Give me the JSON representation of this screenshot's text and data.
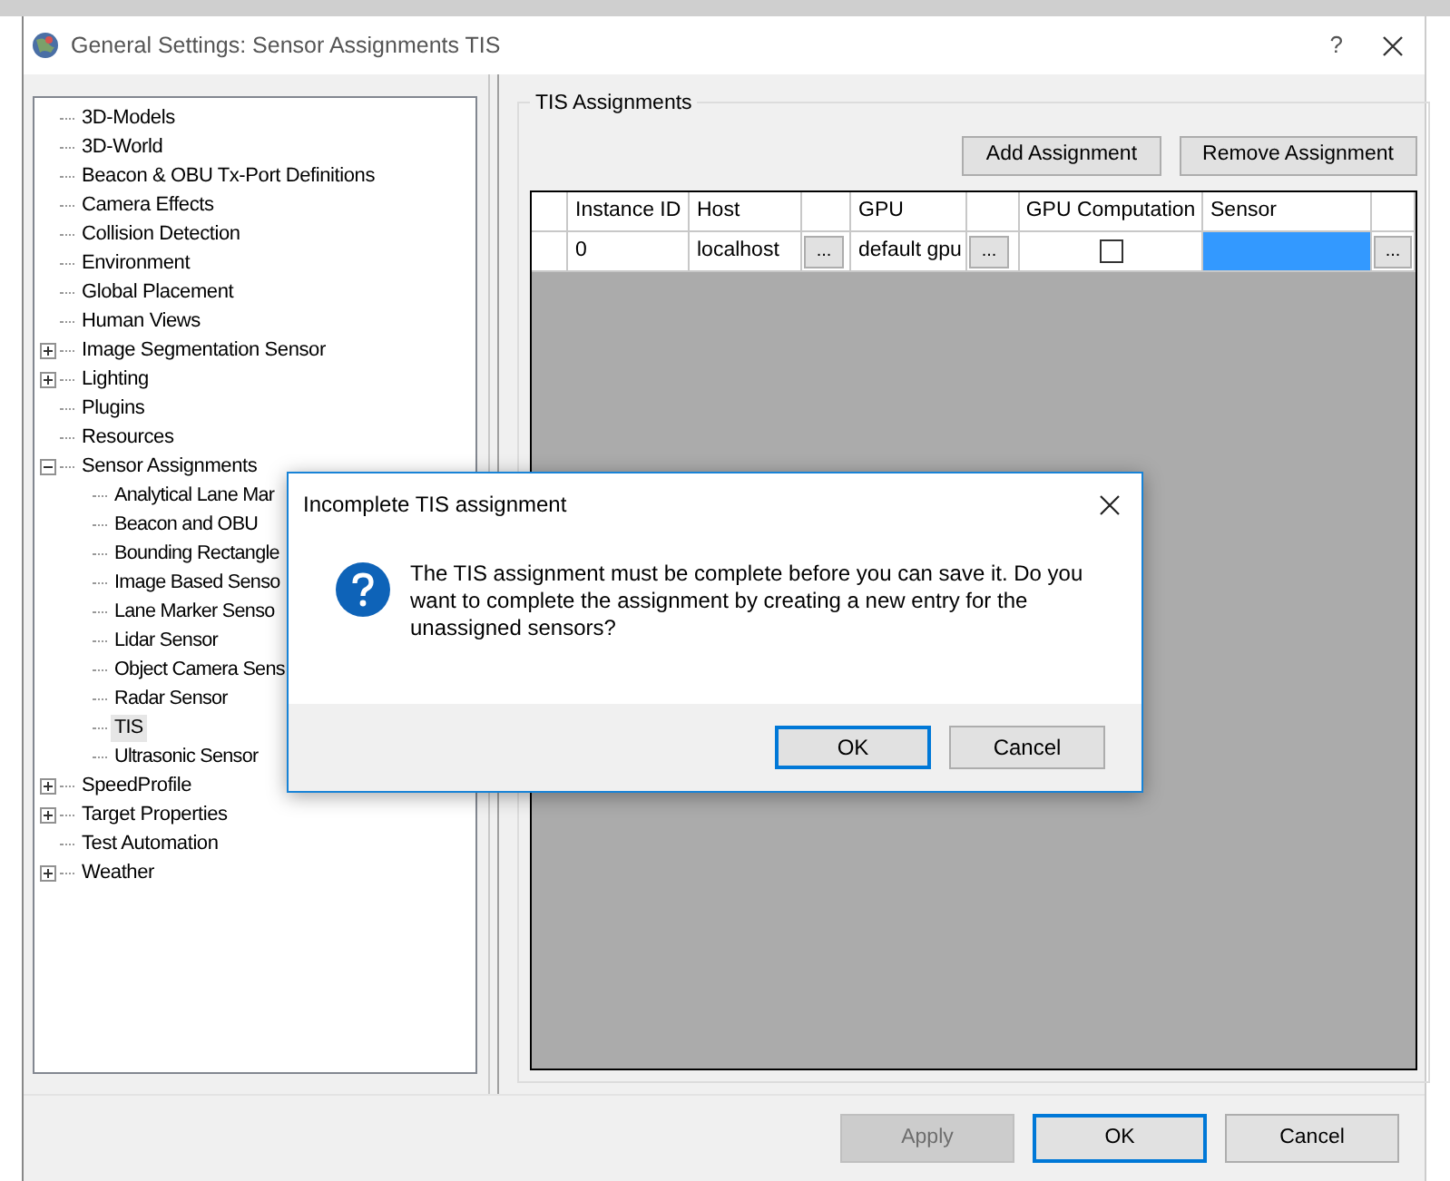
{
  "window": {
    "title": "General Settings: Sensor Assignments TIS",
    "help": "?"
  },
  "tree": [
    {
      "label": "3D-Models",
      "expandable": false,
      "selected": false
    },
    {
      "label": "3D-World",
      "expandable": false,
      "selected": false
    },
    {
      "label": "Beacon & OBU Tx-Port Definitions",
      "expandable": false,
      "selected": false
    },
    {
      "label": "Camera Effects",
      "expandable": false,
      "selected": false
    },
    {
      "label": "Collision Detection",
      "expandable": false,
      "selected": false
    },
    {
      "label": "Environment",
      "expandable": false,
      "selected": false
    },
    {
      "label": "Global Placement",
      "expandable": false,
      "selected": false
    },
    {
      "label": "Human Views",
      "expandable": false,
      "selected": false
    },
    {
      "label": "Image Segmentation Sensor",
      "expandable": true,
      "expanded": false,
      "selected": false
    },
    {
      "label": "Lighting",
      "expandable": true,
      "expanded": false,
      "selected": false
    },
    {
      "label": "Plugins",
      "expandable": false,
      "selected": false
    },
    {
      "label": "Resources",
      "expandable": false,
      "selected": false
    },
    {
      "label": "Sensor Assignments",
      "expandable": true,
      "expanded": true,
      "selected": false,
      "children": [
        {
          "label": "Analytical Lane Mar",
          "selected": false
        },
        {
          "label": "Beacon and OBU",
          "selected": false
        },
        {
          "label": "Bounding Rectangle",
          "selected": false
        },
        {
          "label": "Image Based Senso",
          "selected": false
        },
        {
          "label": "Lane Marker Senso",
          "selected": false
        },
        {
          "label": "Lidar Sensor",
          "selected": false
        },
        {
          "label": "Object Camera Sens",
          "selected": false
        },
        {
          "label": "Radar Sensor",
          "selected": false
        },
        {
          "label": "TIS",
          "selected": true
        },
        {
          "label": "Ultrasonic Sensor",
          "selected": false
        }
      ]
    },
    {
      "label": "SpeedProfile",
      "expandable": true,
      "expanded": false,
      "selected": false
    },
    {
      "label": "Target Properties",
      "expandable": true,
      "expanded": false,
      "selected": false
    },
    {
      "label": "Test Automation",
      "expandable": false,
      "selected": false
    },
    {
      "label": "Weather",
      "expandable": true,
      "expanded": false,
      "selected": false
    }
  ],
  "group": {
    "title": "TIS Assignments",
    "buttons": [
      "Add Assignment",
      "Remove Assignment"
    ]
  },
  "table": {
    "columns": [
      {
        "label": "Instance ID",
        "kind": "text"
      },
      {
        "label": "Host",
        "kind": "text"
      },
      {
        "kind": "button"
      },
      {
        "label": "GPU",
        "kind": "text"
      },
      {
        "kind": "button"
      },
      {
        "label": "GPU Computation",
        "kind": "check"
      },
      {
        "label": "Sensor",
        "kind": "text"
      },
      {
        "kind": "button"
      }
    ],
    "rows": [
      {
        "cells": [
          {
            "kind": "text",
            "value": "0",
            "selected": false
          },
          {
            "kind": "text",
            "value": "localhost",
            "selected": false
          },
          {
            "kind": "button",
            "value": "...",
            "selected": false
          },
          {
            "kind": "text",
            "value": "default gpu",
            "selected": false
          },
          {
            "kind": "button",
            "value": "...",
            "selected": false
          },
          {
            "kind": "check",
            "checked": false,
            "selected": false
          },
          {
            "kind": "text",
            "selected": true
          },
          {
            "kind": "button",
            "value": "...",
            "selected": false
          }
        ]
      }
    ]
  },
  "footer": [
    {
      "label": "Apply",
      "disabled": true,
      "default": false
    },
    {
      "label": "OK",
      "disabled": false,
      "default": true
    },
    {
      "label": "Cancel",
      "disabled": false,
      "default": false
    }
  ],
  "dialog": {
    "title": "Incomplete TIS assignment",
    "message": "The TIS assignment must be complete before you can save it. Do you want to complete the assignment by creating a new entry for the unassigned sensors?",
    "buttons": [
      {
        "label": "OK",
        "default": true
      },
      {
        "label": "Cancel",
        "default": false
      }
    ]
  }
}
